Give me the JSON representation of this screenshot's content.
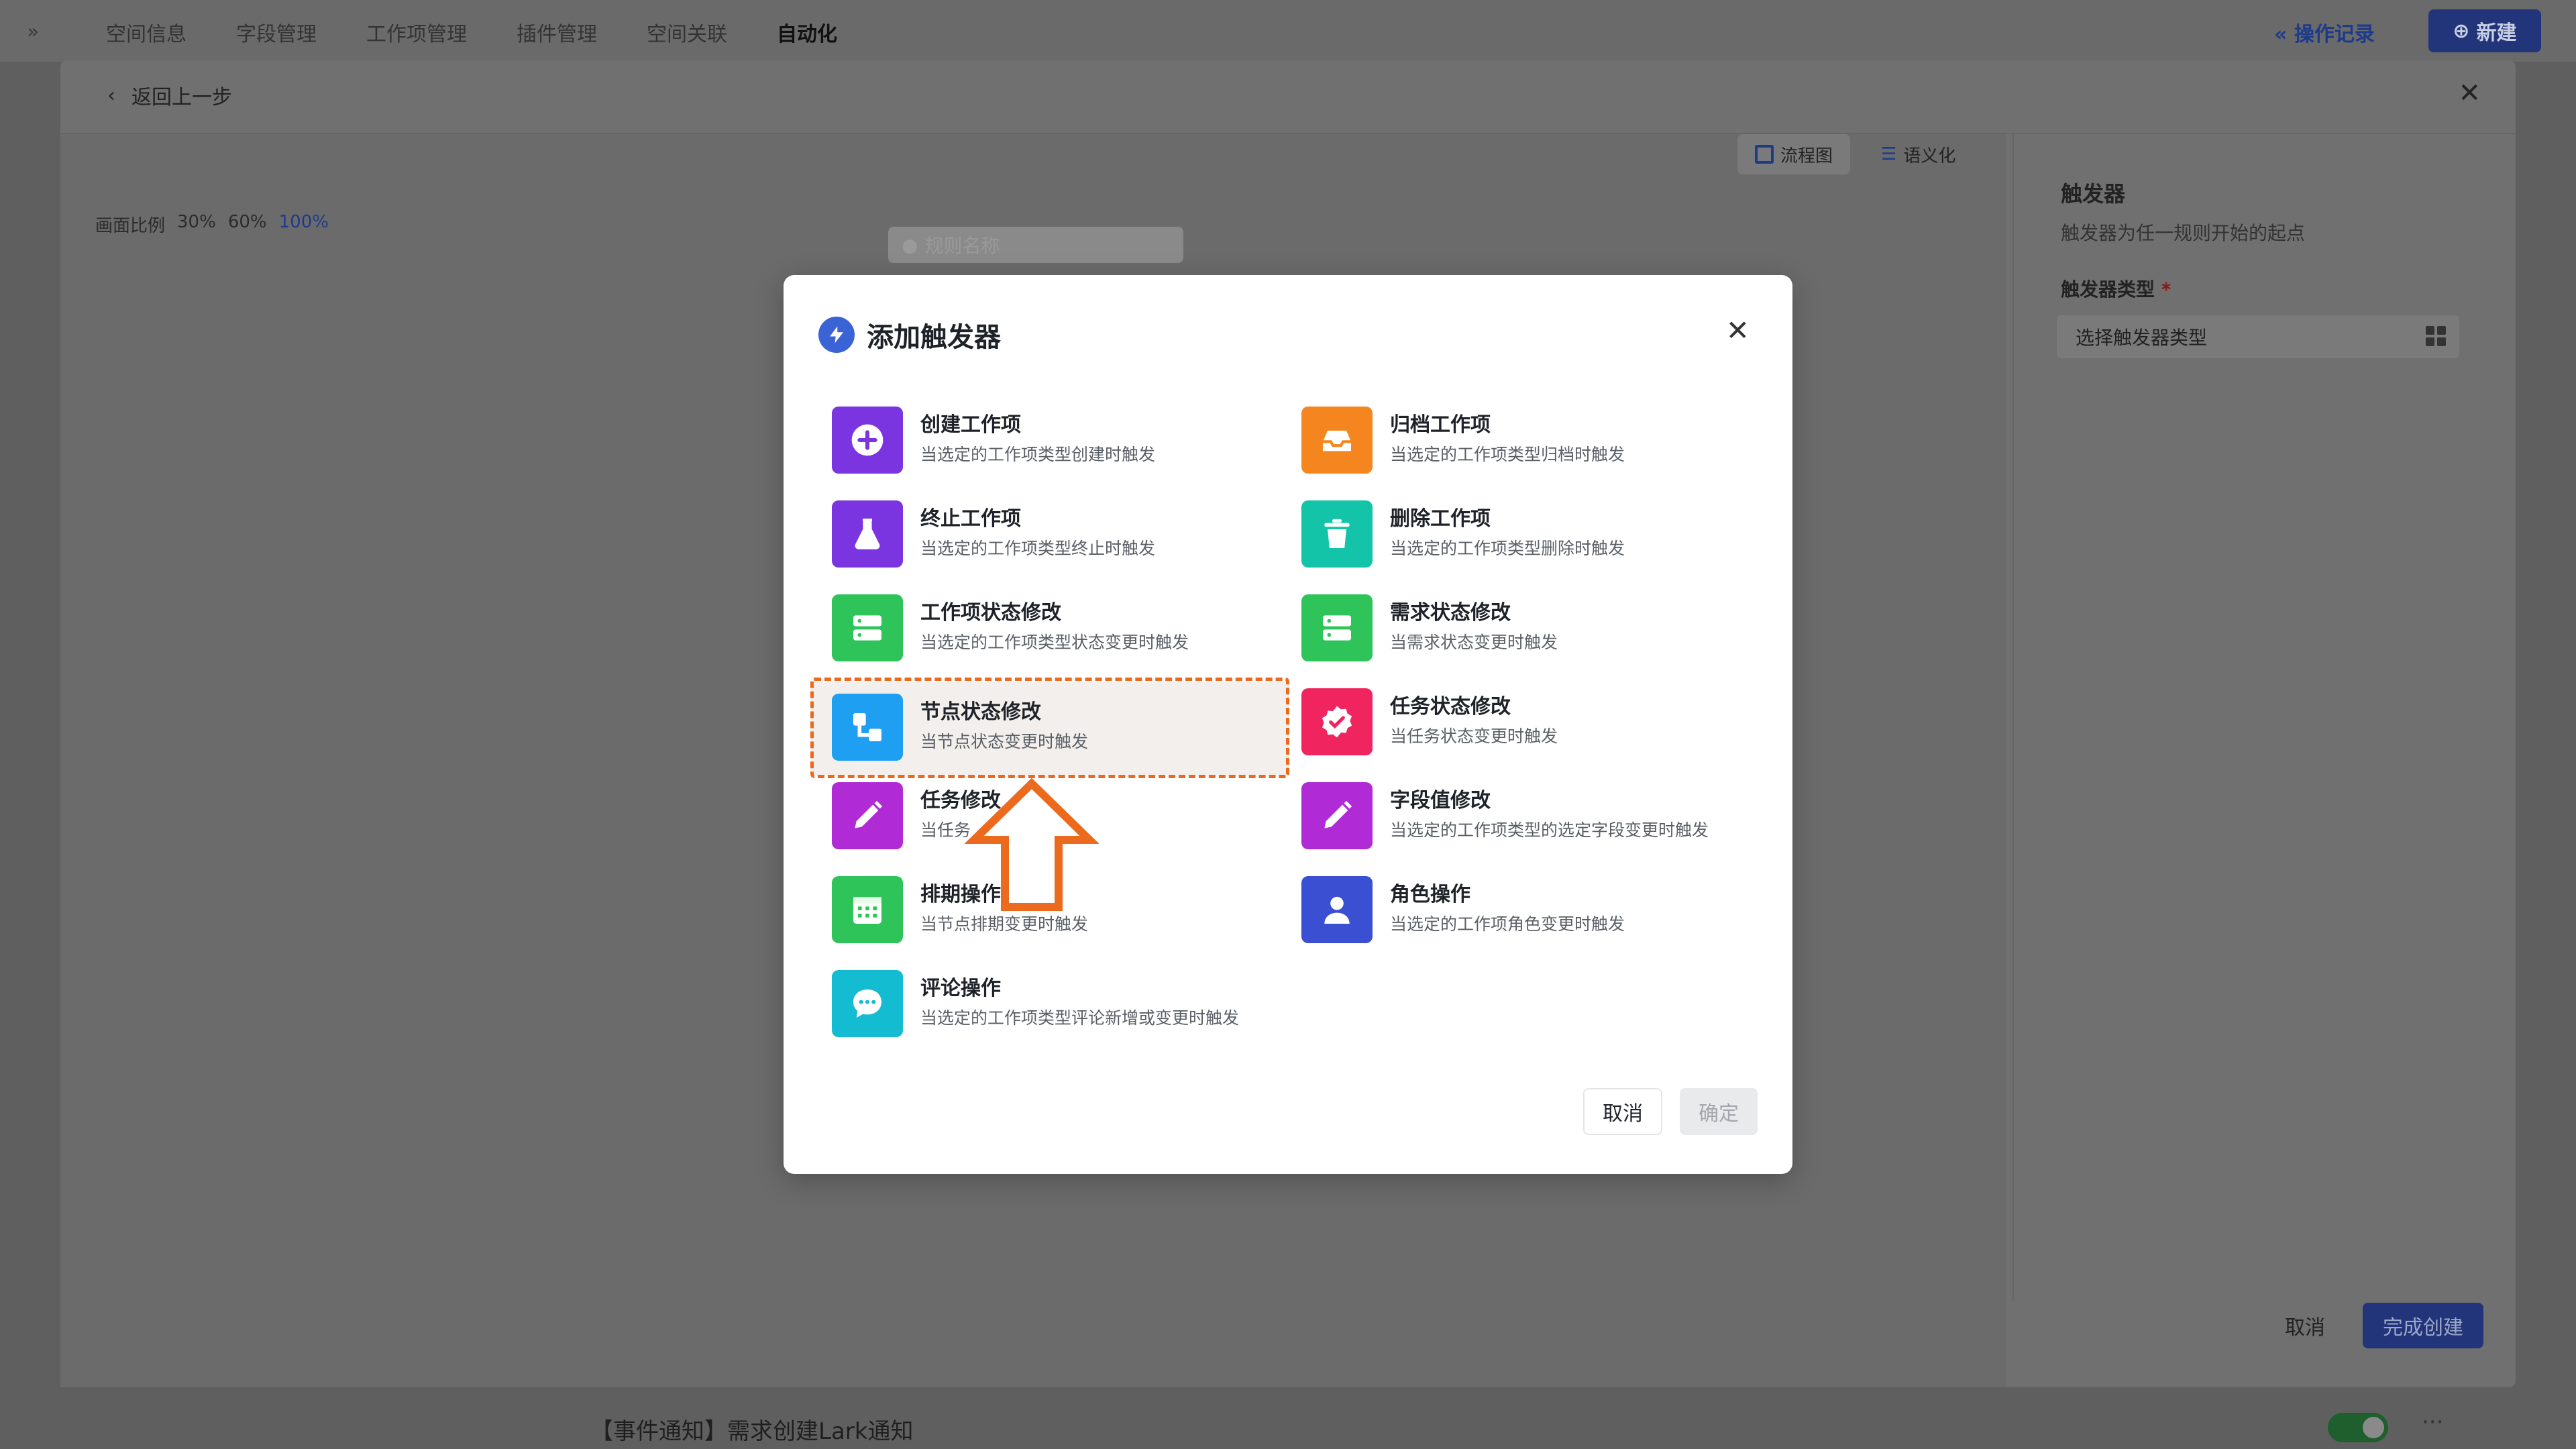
{
  "topnav": {
    "collapse": "»",
    "tabs": [
      "空间信息",
      "字段管理",
      "工作项管理",
      "插件管理",
      "空间关联",
      "自动化"
    ],
    "active_tab": "自动化",
    "log_link": "操作记录",
    "new_button": "新建"
  },
  "panel": {
    "back_label": "返回上一步",
    "close": "✕",
    "view_flow": "流程图",
    "view_semantic": "语义化",
    "zoom_label": "画面比例",
    "zoom_options": [
      "30%",
      "60%",
      "100%"
    ],
    "zoom_active": "100%",
    "rule_name_placeholder": "规则名称",
    "sidebar": {
      "title": "触发器",
      "desc": "触发器为任一规则开始的起点",
      "field_label": "触发器类型",
      "required_mark": "*",
      "select_placeholder": "选择触发器类型"
    },
    "cancel": "取消",
    "finish": "完成创建"
  },
  "bottom_row": {
    "label": "【事件通知】需求创建Lark通知",
    "more": "···"
  },
  "modal": {
    "title": "添加触发器",
    "close": "✕",
    "triggers": [
      {
        "name": "创建工作项",
        "desc": "当选定的工作项类型创建时触发",
        "icon": "plus-circle-icon",
        "color": "#7b35e0"
      },
      {
        "name": "归档工作项",
        "desc": "当选定的工作项类型归档时触发",
        "icon": "inbox-icon",
        "color": "#f5861f"
      },
      {
        "name": "终止工作项",
        "desc": "当选定的工作项类型终止时触发",
        "icon": "flask-icon",
        "color": "#7b35e0"
      },
      {
        "name": "删除工作项",
        "desc": "当选定的工作项类型删除时触发",
        "icon": "trash-icon",
        "color": "#14c4a8"
      },
      {
        "name": "工作项状态修改",
        "desc": "当选定的工作项类型状态变更时触发",
        "icon": "server-icon",
        "color": "#2fc45a"
      },
      {
        "name": "需求状态修改",
        "desc": "当需求状态变更时触发",
        "icon": "server-icon",
        "color": "#2fc45a"
      },
      {
        "name": "节点状态修改",
        "desc": "当节点状态变更时触发",
        "icon": "node-flow-icon",
        "color": "#1e9ff2"
      },
      {
        "name": "任务状态修改",
        "desc": "当任务状态变更时触发",
        "icon": "badge-check-icon",
        "color": "#f0245e"
      },
      {
        "name": "任务修改",
        "desc": "当任务",
        "icon": "pencil-icon",
        "color": "#b02bd6"
      },
      {
        "name": "字段值修改",
        "desc": "当选定的工作项类型的选定字段变更时触发",
        "icon": "pencil-icon",
        "color": "#b02bd6"
      },
      {
        "name": "排期操作",
        "desc": "当节点排期变更时触发",
        "icon": "calendar-icon",
        "color": "#2fc45a"
      },
      {
        "name": "角色操作",
        "desc": "当选定的工作项角色变更时触发",
        "icon": "user-icon",
        "color": "#3a4fd1"
      },
      {
        "name": "评论操作",
        "desc": "当选定的工作项类型评论新增或变更时触发",
        "icon": "chat-icon",
        "color": "#14bcd1"
      }
    ],
    "highlight_color": "#ec6a1d",
    "cancel": "取消",
    "ok": "确定"
  }
}
